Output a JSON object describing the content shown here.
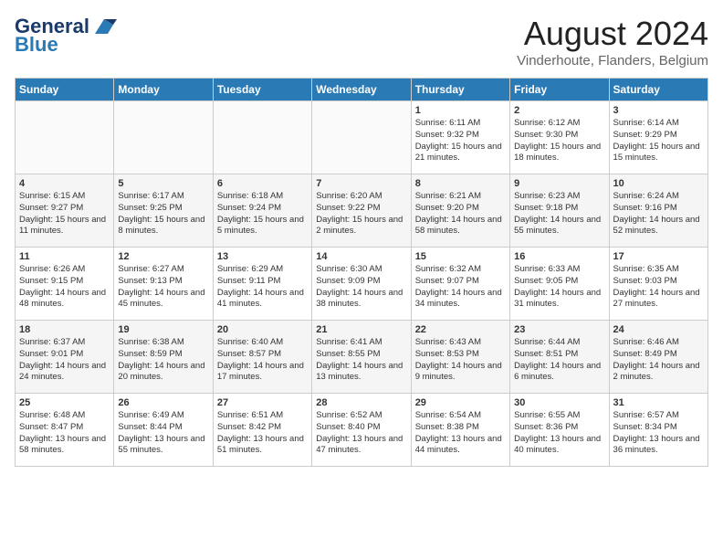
{
  "header": {
    "logo_line1": "General",
    "logo_line2": "Blue",
    "month_year": "August 2024",
    "location": "Vinderhoute, Flanders, Belgium"
  },
  "days_of_week": [
    "Sunday",
    "Monday",
    "Tuesday",
    "Wednesday",
    "Thursday",
    "Friday",
    "Saturday"
  ],
  "weeks": [
    [
      {
        "day": "",
        "info": ""
      },
      {
        "day": "",
        "info": ""
      },
      {
        "day": "",
        "info": ""
      },
      {
        "day": "",
        "info": ""
      },
      {
        "day": "1",
        "info": "Sunrise: 6:11 AM\nSunset: 9:32 PM\nDaylight: 15 hours and 21 minutes."
      },
      {
        "day": "2",
        "info": "Sunrise: 6:12 AM\nSunset: 9:30 PM\nDaylight: 15 hours and 18 minutes."
      },
      {
        "day": "3",
        "info": "Sunrise: 6:14 AM\nSunset: 9:29 PM\nDaylight: 15 hours and 15 minutes."
      }
    ],
    [
      {
        "day": "4",
        "info": "Sunrise: 6:15 AM\nSunset: 9:27 PM\nDaylight: 15 hours and 11 minutes."
      },
      {
        "day": "5",
        "info": "Sunrise: 6:17 AM\nSunset: 9:25 PM\nDaylight: 15 hours and 8 minutes."
      },
      {
        "day": "6",
        "info": "Sunrise: 6:18 AM\nSunset: 9:24 PM\nDaylight: 15 hours and 5 minutes."
      },
      {
        "day": "7",
        "info": "Sunrise: 6:20 AM\nSunset: 9:22 PM\nDaylight: 15 hours and 2 minutes."
      },
      {
        "day": "8",
        "info": "Sunrise: 6:21 AM\nSunset: 9:20 PM\nDaylight: 14 hours and 58 minutes."
      },
      {
        "day": "9",
        "info": "Sunrise: 6:23 AM\nSunset: 9:18 PM\nDaylight: 14 hours and 55 minutes."
      },
      {
        "day": "10",
        "info": "Sunrise: 6:24 AM\nSunset: 9:16 PM\nDaylight: 14 hours and 52 minutes."
      }
    ],
    [
      {
        "day": "11",
        "info": "Sunrise: 6:26 AM\nSunset: 9:15 PM\nDaylight: 14 hours and 48 minutes."
      },
      {
        "day": "12",
        "info": "Sunrise: 6:27 AM\nSunset: 9:13 PM\nDaylight: 14 hours and 45 minutes."
      },
      {
        "day": "13",
        "info": "Sunrise: 6:29 AM\nSunset: 9:11 PM\nDaylight: 14 hours and 41 minutes."
      },
      {
        "day": "14",
        "info": "Sunrise: 6:30 AM\nSunset: 9:09 PM\nDaylight: 14 hours and 38 minutes."
      },
      {
        "day": "15",
        "info": "Sunrise: 6:32 AM\nSunset: 9:07 PM\nDaylight: 14 hours and 34 minutes."
      },
      {
        "day": "16",
        "info": "Sunrise: 6:33 AM\nSunset: 9:05 PM\nDaylight: 14 hours and 31 minutes."
      },
      {
        "day": "17",
        "info": "Sunrise: 6:35 AM\nSunset: 9:03 PM\nDaylight: 14 hours and 27 minutes."
      }
    ],
    [
      {
        "day": "18",
        "info": "Sunrise: 6:37 AM\nSunset: 9:01 PM\nDaylight: 14 hours and 24 minutes."
      },
      {
        "day": "19",
        "info": "Sunrise: 6:38 AM\nSunset: 8:59 PM\nDaylight: 14 hours and 20 minutes."
      },
      {
        "day": "20",
        "info": "Sunrise: 6:40 AM\nSunset: 8:57 PM\nDaylight: 14 hours and 17 minutes."
      },
      {
        "day": "21",
        "info": "Sunrise: 6:41 AM\nSunset: 8:55 PM\nDaylight: 14 hours and 13 minutes."
      },
      {
        "day": "22",
        "info": "Sunrise: 6:43 AM\nSunset: 8:53 PM\nDaylight: 14 hours and 9 minutes."
      },
      {
        "day": "23",
        "info": "Sunrise: 6:44 AM\nSunset: 8:51 PM\nDaylight: 14 hours and 6 minutes."
      },
      {
        "day": "24",
        "info": "Sunrise: 6:46 AM\nSunset: 8:49 PM\nDaylight: 14 hours and 2 minutes."
      }
    ],
    [
      {
        "day": "25",
        "info": "Sunrise: 6:48 AM\nSunset: 8:47 PM\nDaylight: 13 hours and 58 minutes."
      },
      {
        "day": "26",
        "info": "Sunrise: 6:49 AM\nSunset: 8:44 PM\nDaylight: 13 hours and 55 minutes."
      },
      {
        "day": "27",
        "info": "Sunrise: 6:51 AM\nSunset: 8:42 PM\nDaylight: 13 hours and 51 minutes."
      },
      {
        "day": "28",
        "info": "Sunrise: 6:52 AM\nSunset: 8:40 PM\nDaylight: 13 hours and 47 minutes."
      },
      {
        "day": "29",
        "info": "Sunrise: 6:54 AM\nSunset: 8:38 PM\nDaylight: 13 hours and 44 minutes."
      },
      {
        "day": "30",
        "info": "Sunrise: 6:55 AM\nSunset: 8:36 PM\nDaylight: 13 hours and 40 minutes."
      },
      {
        "day": "31",
        "info": "Sunrise: 6:57 AM\nSunset: 8:34 PM\nDaylight: 13 hours and 36 minutes."
      }
    ]
  ]
}
